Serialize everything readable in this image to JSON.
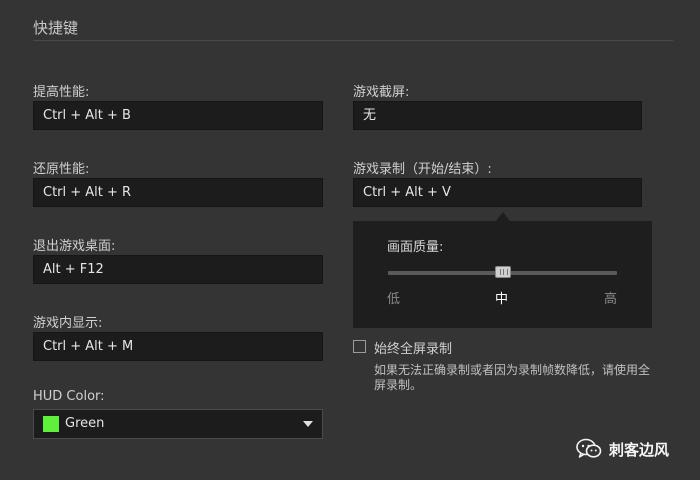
{
  "section": {
    "title": "快捷键"
  },
  "left": {
    "boost": {
      "label": "提高性能:",
      "value": "Ctrl + Alt + B"
    },
    "restore": {
      "label": "还原性能:",
      "value": "Ctrl + Alt + R"
    },
    "exit_desktop": {
      "label": "退出游戏桌面:",
      "value": "Alt + F12"
    },
    "in_game_display": {
      "label": "游戏内显示:",
      "value": "Ctrl + Alt + M"
    },
    "hud_color": {
      "label": "HUD Color:",
      "selected": "Green",
      "swatch_color": "#5ef03a"
    }
  },
  "right": {
    "screenshot": {
      "label": "游戏截屏:",
      "value": "无"
    },
    "recording": {
      "label": "游戏录制（开始/结束）:",
      "value": "Ctrl + Alt + V"
    },
    "quality_popup": {
      "title": "画面质量:",
      "levels": [
        "低",
        "中",
        "高"
      ],
      "selected_level": "中",
      "slider_value": 0.5
    },
    "fullscreen_record": {
      "label": "始终全屏录制",
      "checked": false,
      "hint": "如果无法正确录制或者因为录制帧数降低，请使用全屏录制。"
    }
  },
  "watermark": {
    "text": "刺客边风",
    "icon": "wechat-icon"
  },
  "colors": {
    "background": "#343434",
    "input_background": "#1c1c1c",
    "popup_background": "#1e1e1e"
  }
}
